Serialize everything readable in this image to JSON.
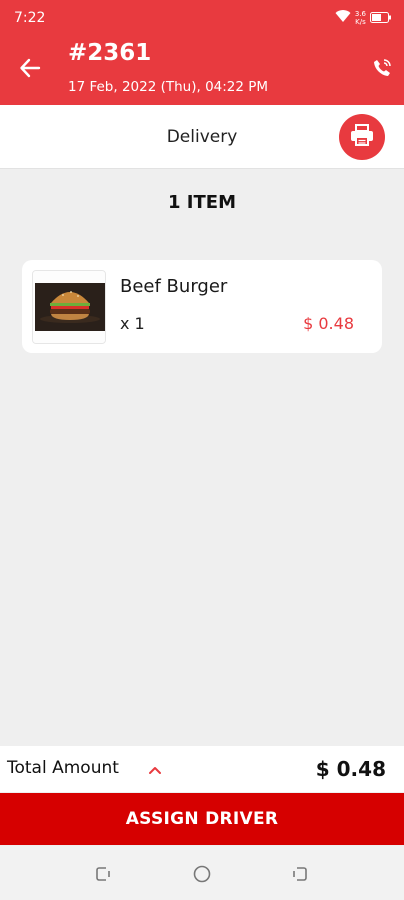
{
  "status_bar": {
    "time": "7:22",
    "net_speed_value": "3.6",
    "net_speed_unit": "K/s",
    "icons": [
      "wifi-icon",
      "battery-icon"
    ]
  },
  "header": {
    "order_number": "#2361",
    "order_datetime": "17 Feb, 2022 (Thu), 04:22 PM",
    "icons": [
      "back-arrow-icon",
      "phone-icon"
    ]
  },
  "tab": {
    "label": "Delivery",
    "print_icon": "printer-icon"
  },
  "items_summary": {
    "title": "1 ITEM"
  },
  "items": [
    {
      "name": "Beef Burger",
      "quantity": "x 1",
      "price": "$ 0.48",
      "image": "burger-image"
    }
  ],
  "totals": {
    "label": "Total Amount",
    "value": "$ 0.48",
    "toggle_icon": "chevron-up-icon"
  },
  "actions": {
    "assign_driver": "ASSIGN DRIVER"
  },
  "nav": {
    "icons": [
      "recents-icon",
      "home-icon",
      "back-icon"
    ]
  },
  "colors": {
    "primary": "#e83a3f",
    "button": "#d60000",
    "background": "#efefef",
    "price": "#e83a3f"
  }
}
